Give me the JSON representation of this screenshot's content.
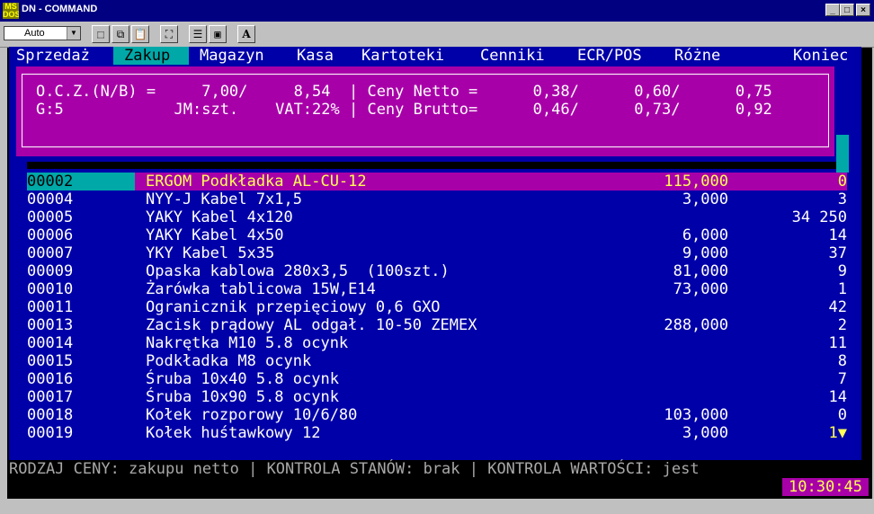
{
  "window": {
    "title": "DN - COMMAND",
    "icon_label": "MS DOS"
  },
  "toolbar": {
    "font_select": "Auto",
    "text_button": "A"
  },
  "menu": [
    "Sprzedaż",
    "Zakup",
    "Magazyn",
    "Kasa",
    "Kartoteki",
    "Cenniki",
    "ECR/POS",
    "Różne",
    "Koniec"
  ],
  "popup": {
    "line1": "O.C.Z.(N/B) =     7,00/     8,54  | Ceny Netto =      0,38/      0,60/      0,75",
    "line2": "G:5            JM:szt.    VAT:22% | Ceny Brutto=      0,46/      0,73/      0,92"
  },
  "rows": [
    {
      "code": "00002",
      "name": "ERGOM Podkładka AL-CU-12",
      "price": "115,000",
      "stock": "0"
    },
    {
      "code": "00004",
      "name": "NYY-J Kabel 7x1,5",
      "price": "3,000",
      "stock": "3"
    },
    {
      "code": "00005",
      "name": "YAKY Kabel 4x120",
      "price": "",
      "stock": "34 250"
    },
    {
      "code": "00006",
      "name": "YAKY Kabel 4x50",
      "price": "6,000",
      "stock": "14"
    },
    {
      "code": "00007",
      "name": "YKY Kabel 5x35",
      "price": "9,000",
      "stock": "37"
    },
    {
      "code": "00009",
      "name": "Opaska kablowa 280x3,5  (100szt.)",
      "price": "81,000",
      "stock": "9"
    },
    {
      "code": "00010",
      "name": "Żarówka tablicowa 15W,E14",
      "price": "73,000",
      "stock": "1"
    },
    {
      "code": "00011",
      "name": "Ogranicznik przepięciowy 0,6 GXO",
      "price": "",
      "stock": "42"
    },
    {
      "code": "00013",
      "name": "Zacisk prądowy AL odgał. 10-50 ZEMEX",
      "price": "288,000",
      "stock": "2"
    },
    {
      "code": "00014",
      "name": "Nakrętka M10 5.8 ocynk",
      "price": "",
      "stock": "11"
    },
    {
      "code": "00015",
      "name": "Podkładka M8 ocynk",
      "price": "",
      "stock": "8"
    },
    {
      "code": "00016",
      "name": "Śruba 10x40 5.8 ocynk",
      "price": "",
      "stock": "7"
    },
    {
      "code": "00017",
      "name": "Śruba 10x90 5.8 ocynk",
      "price": "",
      "stock": "14"
    },
    {
      "code": "00018",
      "name": "Kołek rozporowy 10/6/80",
      "price": "103,000",
      "stock": "0"
    },
    {
      "code": "00019",
      "name": "Kołek huśtawkowy 12",
      "price": "3,000",
      "stock": "1▼"
    }
  ],
  "status": "RODZAJ CENY: zakupu netto | KONTROLA STANÓW: brak | KONTROLA WARTOŚCI: jest",
  "clock": "10:30:45",
  "colors": {
    "blue": "#0000a8",
    "magenta": "#a800a8",
    "cyan": "#00a8a8",
    "yellow": "#ffff54"
  }
}
